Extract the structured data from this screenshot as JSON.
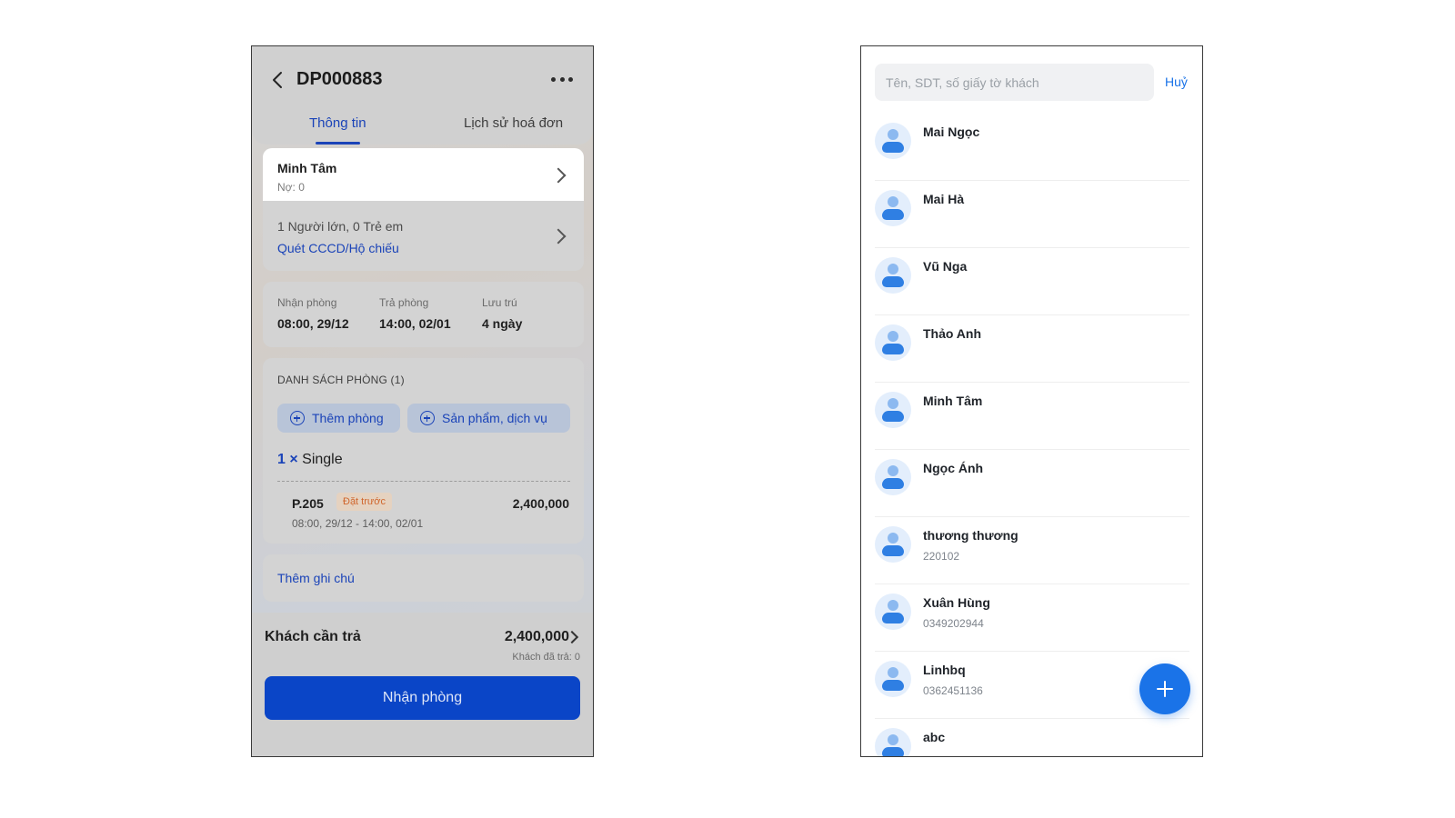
{
  "booking": {
    "title": "DP000883",
    "tabs": [
      {
        "label": "Thông tin"
      },
      {
        "label": "Lịch sử hoá đơn"
      }
    ],
    "guest": {
      "name": "Minh Tâm",
      "debt": "Nợ: 0",
      "count": "1 Người lớn, 0 Trẻ em",
      "scan_link": "Quét CCCD/Hộ chiếu"
    },
    "dates": [
      {
        "label": "Nhận phòng",
        "value": "08:00, 29/12"
      },
      {
        "label": "Trả phòng",
        "value": "14:00, 02/01"
      },
      {
        "label": "Lưu trú",
        "value": "4 ngày"
      }
    ],
    "rooms": {
      "title": "DANH SÁCH PHÒNG (1)",
      "add_room": "Thêm phòng",
      "add_service": "Sản phẩm, dịch vụ",
      "qty": "1 ×",
      "type": "Single",
      "room_no": "P.205",
      "status": "Đặt trước",
      "price": "2,400,000",
      "time": "08:00, 29/12 - 14:00, 02/01"
    },
    "note_link": "Thêm ghi chú",
    "footer": {
      "pay_label": "Khách cần trả",
      "pay_amount": "2,400,000",
      "paid": "Khách đã trả: 0",
      "checkin_button": "Nhận phòng"
    }
  },
  "customers": {
    "search_placeholder": "Tên, SDT, số giấy tờ khách",
    "cancel": "Huỷ",
    "items": [
      {
        "name": "Mai Ngọc",
        "phone": ""
      },
      {
        "name": "Mai Hà",
        "phone": ""
      },
      {
        "name": "Vũ Nga",
        "phone": ""
      },
      {
        "name": "Thảo Anh",
        "phone": ""
      },
      {
        "name": "Minh Tâm",
        "phone": ""
      },
      {
        "name": "Ngọc Ánh",
        "phone": ""
      },
      {
        "name": "thương thương",
        "phone": "220102"
      },
      {
        "name": "Xuân Hùng",
        "phone": "0349202944"
      },
      {
        "name": "Linhbq",
        "phone": "0362451136"
      },
      {
        "name": "abc",
        "phone": ""
      }
    ]
  },
  "colors": {
    "primary": "#0a45c7",
    "link": "#1a43b8",
    "accent": "#1a73e8",
    "badge_text": "#d0662c"
  }
}
